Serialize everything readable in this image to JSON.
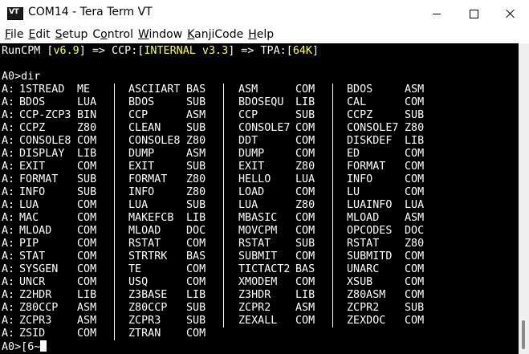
{
  "window": {
    "title": "COM14 - Tera Term VT",
    "icon_label": "VT"
  },
  "menubar": [
    {
      "pre": "",
      "u": "F",
      "post": "ile"
    },
    {
      "pre": "",
      "u": "E",
      "post": "dit"
    },
    {
      "pre": "",
      "u": "S",
      "post": "etup"
    },
    {
      "pre": "C",
      "u": "o",
      "post": "ntrol"
    },
    {
      "pre": "",
      "u": "W",
      "post": "indow"
    },
    {
      "pre": "",
      "u": "K",
      "post": "anjiCode"
    },
    {
      "pre": "",
      "u": "H",
      "post": "elp"
    }
  ],
  "terminal": {
    "banner": {
      "p1": "RunCPM [",
      "version": "v6.9",
      "p2": "] => CCP:[",
      "ccp": "INTERNAL v3.3",
      "p3": "] => TPA:[",
      "tpa": "64K",
      "p4": "]"
    },
    "command_line": "A0>dir",
    "prompt_final": "A0>[6~",
    "drive_prefix": "A:",
    "rows": [
      [
        [
          "1STREAD",
          "ME"
        ],
        [
          "ASCIIART",
          "BAS"
        ],
        [
          "ASM",
          "COM"
        ],
        [
          "BDOS",
          "ASM"
        ]
      ],
      [
        [
          "BDOS",
          "LUA"
        ],
        [
          "BDOS",
          "SUB"
        ],
        [
          "BDOSEQU",
          "LIB"
        ],
        [
          "CAL",
          "COM"
        ]
      ],
      [
        [
          "CCP-ZCP3",
          "BIN"
        ],
        [
          "CCP",
          "ASM"
        ],
        [
          "CCP",
          "SUB"
        ],
        [
          "CCPZ",
          "SUB"
        ]
      ],
      [
        [
          "CCPZ",
          "Z80"
        ],
        [
          "CLEAN",
          "SUB"
        ],
        [
          "CONSOLE7",
          "COM"
        ],
        [
          "CONSOLE7",
          "Z80"
        ]
      ],
      [
        [
          "CONSOLE8",
          "COM"
        ],
        [
          "CONSOLE8",
          "Z80"
        ],
        [
          "DDT",
          "COM"
        ],
        [
          "DISKDEF",
          "LIB"
        ]
      ],
      [
        [
          "DISPLAY",
          "LIB"
        ],
        [
          "DUMP",
          "ASM"
        ],
        [
          "DUMP",
          "COM"
        ],
        [
          "ED",
          "COM"
        ]
      ],
      [
        [
          "EXIT",
          "COM"
        ],
        [
          "EXIT",
          "SUB"
        ],
        [
          "EXIT",
          "Z80"
        ],
        [
          "FORMAT",
          "COM"
        ]
      ],
      [
        [
          "FORMAT",
          "SUB"
        ],
        [
          "FORMAT",
          "Z80"
        ],
        [
          "HELLO",
          "LUA"
        ],
        [
          "INFO",
          "COM"
        ]
      ],
      [
        [
          "INFO",
          "SUB"
        ],
        [
          "INFO",
          "Z80"
        ],
        [
          "LOAD",
          "COM"
        ],
        [
          "LU",
          "COM"
        ]
      ],
      [
        [
          "LUA",
          "COM"
        ],
        [
          "LUA",
          "SUB"
        ],
        [
          "LUA",
          "Z80"
        ],
        [
          "LUAINFO",
          "LUA"
        ]
      ],
      [
        [
          "MAC",
          "COM"
        ],
        [
          "MAKEFCB",
          "LIB"
        ],
        [
          "MBASIC",
          "COM"
        ],
        [
          "MLOAD",
          "ASM"
        ]
      ],
      [
        [
          "MLOAD",
          "COM"
        ],
        [
          "MLOAD",
          "DOC"
        ],
        [
          "MOVCPM",
          "COM"
        ],
        [
          "OPCODES",
          "DOC"
        ]
      ],
      [
        [
          "PIP",
          "COM"
        ],
        [
          "RSTAT",
          "COM"
        ],
        [
          "RSTAT",
          "SUB"
        ],
        [
          "RSTAT",
          "Z80"
        ]
      ],
      [
        [
          "STAT",
          "COM"
        ],
        [
          "STRTRK",
          "BAS"
        ],
        [
          "SUBMIT",
          "COM"
        ],
        [
          "SUBMITD",
          "COM"
        ]
      ],
      [
        [
          "SYSGEN",
          "COM"
        ],
        [
          "TE",
          "COM"
        ],
        [
          "TICTACT2",
          "BAS"
        ],
        [
          "UNARC",
          "COM"
        ]
      ],
      [
        [
          "UNCR",
          "COM"
        ],
        [
          "USQ",
          "COM"
        ],
        [
          "XMODEM",
          "COM"
        ],
        [
          "XSUB",
          "COM"
        ]
      ],
      [
        [
          "Z2HDR",
          "LIB"
        ],
        [
          "Z3BASE",
          "LIB"
        ],
        [
          "Z3HDR",
          "LIB"
        ],
        [
          "Z80ASM",
          "COM"
        ]
      ],
      [
        [
          "Z80CCP",
          "ASM"
        ],
        [
          "Z80CCP",
          "SUB"
        ],
        [
          "ZCPR2",
          "ASM"
        ],
        [
          "ZCPR2",
          "SUB"
        ]
      ],
      [
        [
          "ZCPR3",
          "ASM"
        ],
        [
          "ZCPR3",
          "SUB"
        ],
        [
          "ZEXALL",
          "COM"
        ],
        [
          "ZEXDOC",
          "COM"
        ]
      ],
      [
        [
          "ZSID",
          "COM"
        ],
        [
          "ZTRAN",
          "COM"
        ]
      ]
    ]
  },
  "colors": {
    "terminal_bg": "#000000",
    "terminal_fg": "#ffffff",
    "highlight": "#ffff55"
  }
}
